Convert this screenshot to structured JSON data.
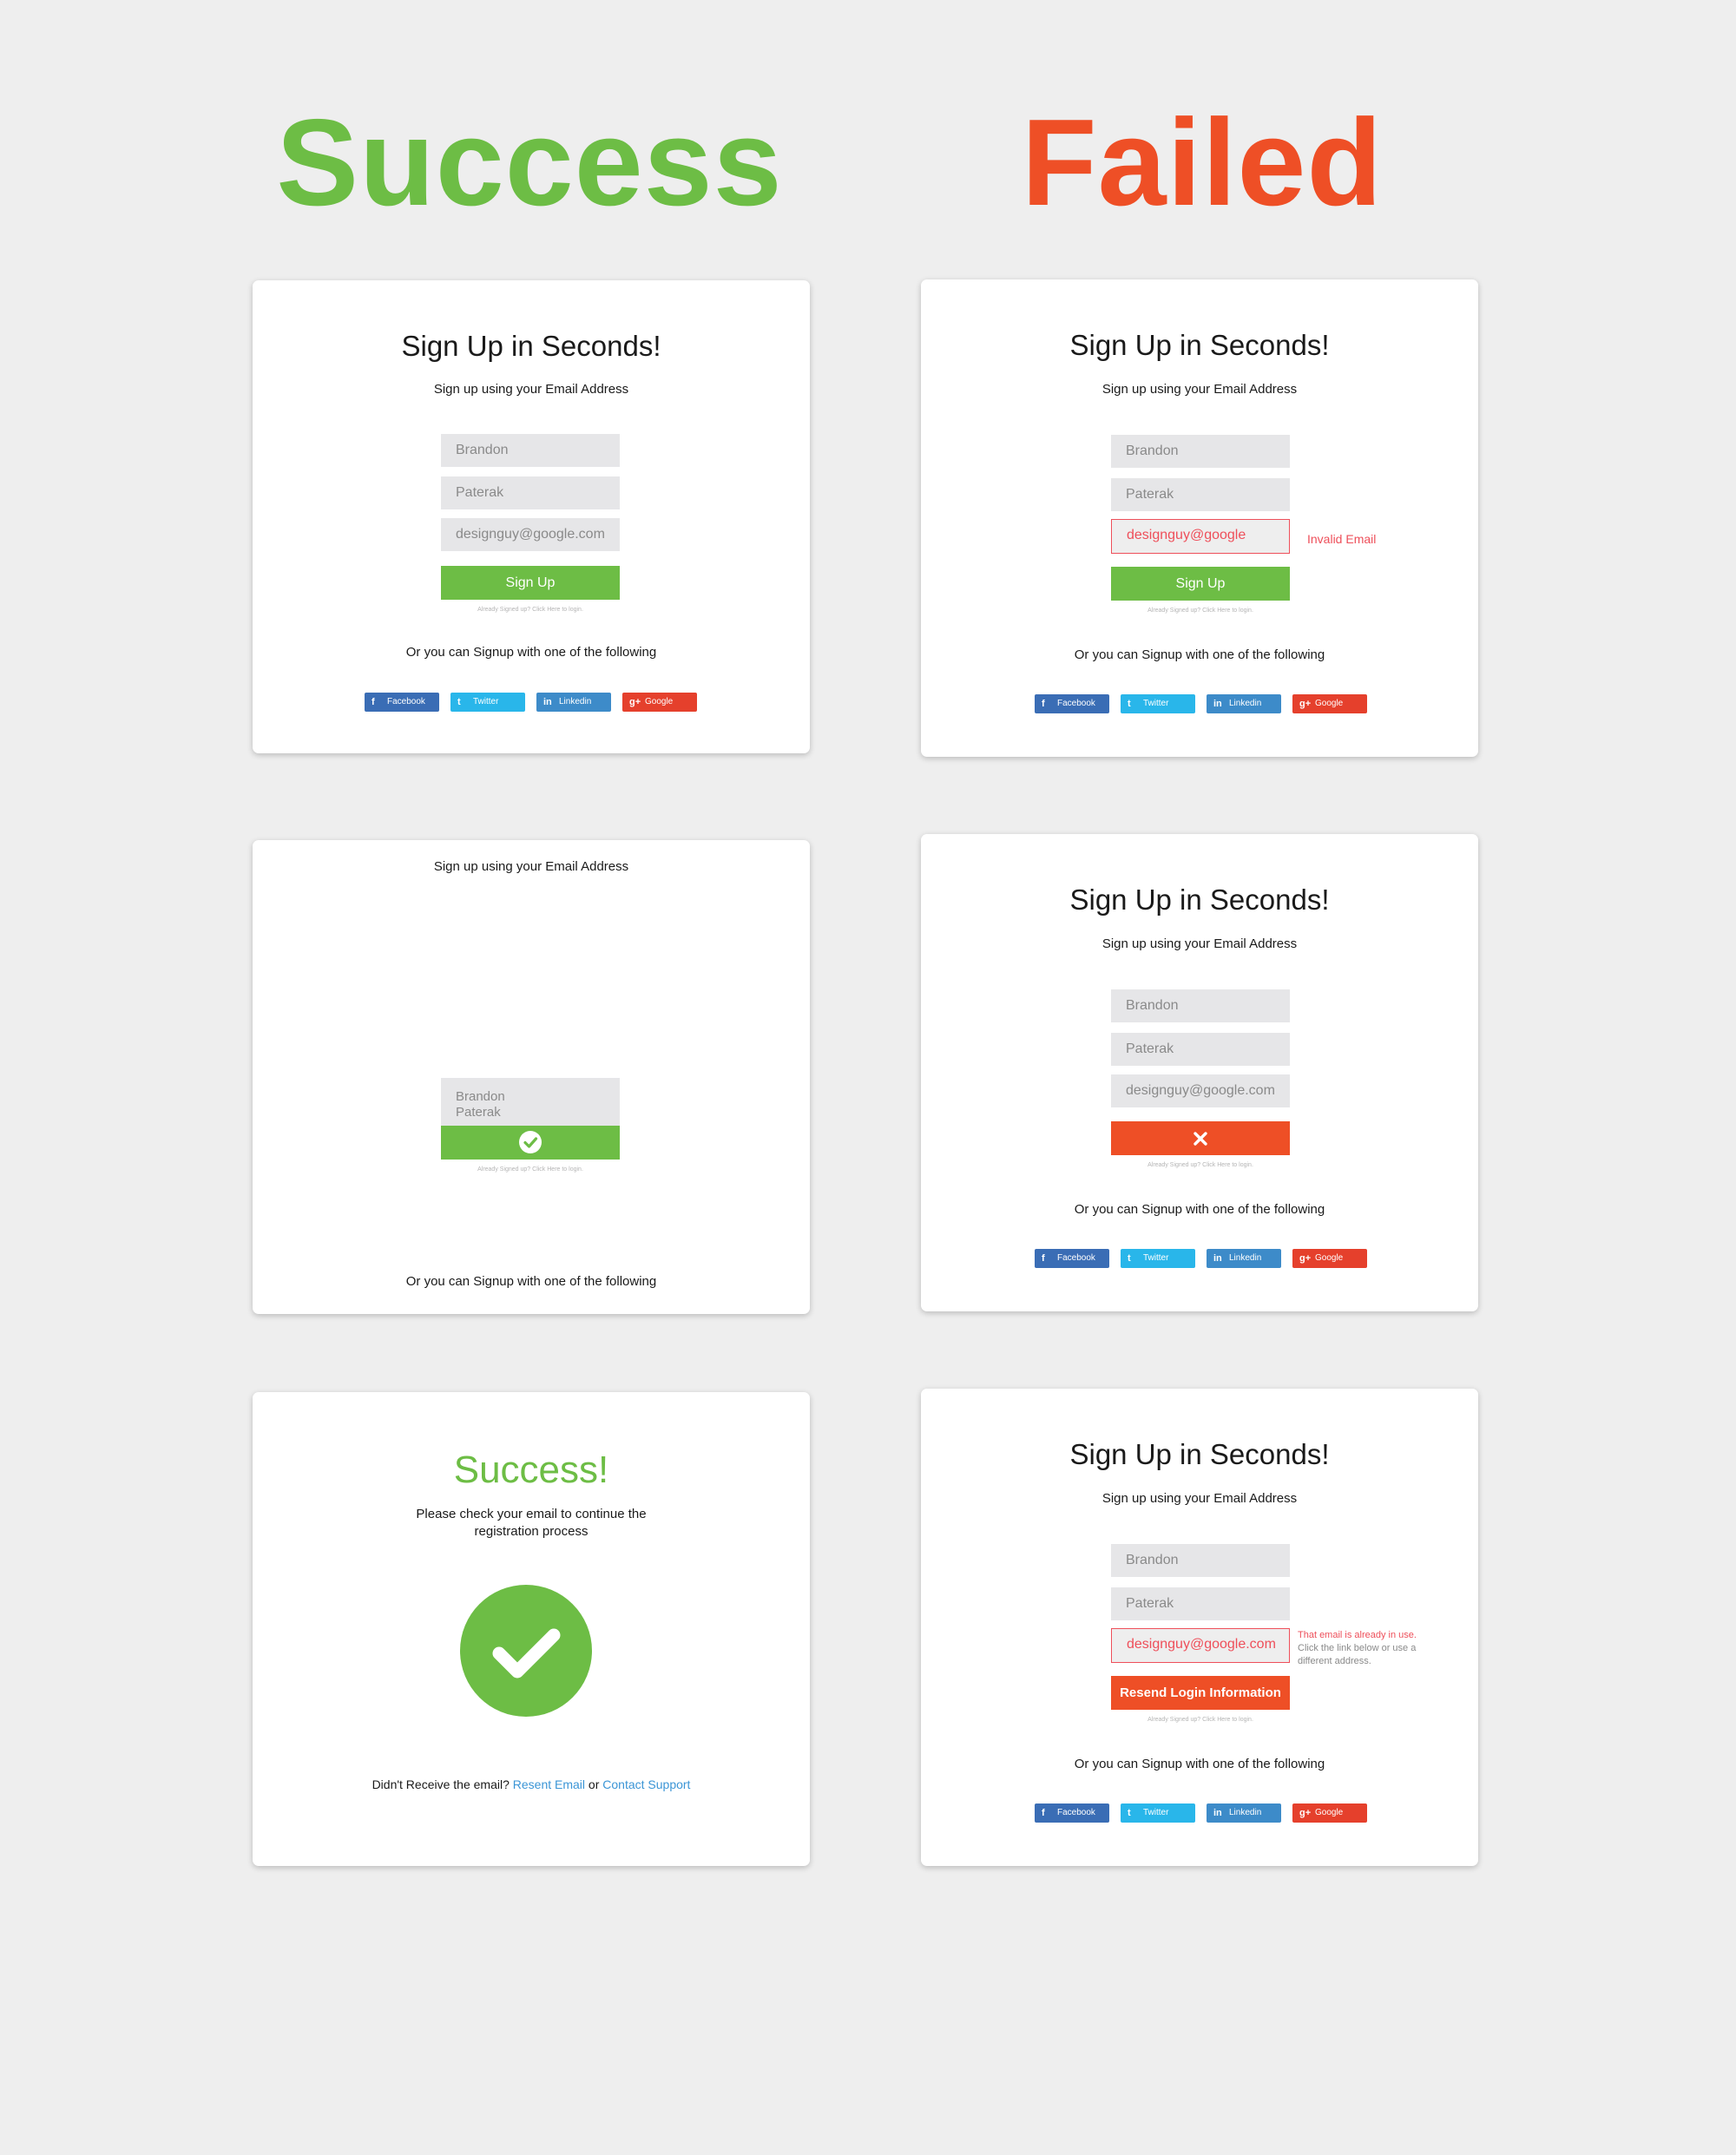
{
  "headings": {
    "success": "Success",
    "failed": "Failed"
  },
  "form": {
    "title": "Sign Up in Seconds!",
    "subtitle": "Sign up using your Email Address",
    "first_name": "Brandon",
    "last_name": "Paterak",
    "email": "designguy@google.com",
    "email_invalid": "designguy@google",
    "signup_label": "Sign Up",
    "login_note": "Already Signed up? Click Here to login.",
    "or_text": "Or you can Signup with one of the following"
  },
  "social": [
    {
      "label": "Facebook",
      "icon": "f",
      "color": "#3a6db5"
    },
    {
      "label": "Twitter",
      "icon": "t",
      "color": "#29b6ea"
    },
    {
      "label": "Linkedin",
      "icon": "in",
      "color": "#3d8bc9"
    },
    {
      "label": "Google",
      "icon": "g+",
      "color": "#e5402c"
    }
  ],
  "errors": {
    "invalid_email": "Invalid Email",
    "in_use_line1": "That email is already in use.",
    "in_use_line2": "Click the link below or use a different address.",
    "resend_button": "Resend Login Information"
  },
  "success_card": {
    "title": "Success!",
    "message_line1": "Please check your email to continue the",
    "message_line2": "registration process",
    "didnt_receive": "Didn't Receive the email?",
    "resend_link": "Resent Email",
    "or": "or",
    "support_link": "Contact Support"
  },
  "colors": {
    "success_green": "#6dbd45",
    "failed_orange": "#ee4f26",
    "error_red": "#ee4f5a",
    "link_blue": "#3b95d6"
  }
}
